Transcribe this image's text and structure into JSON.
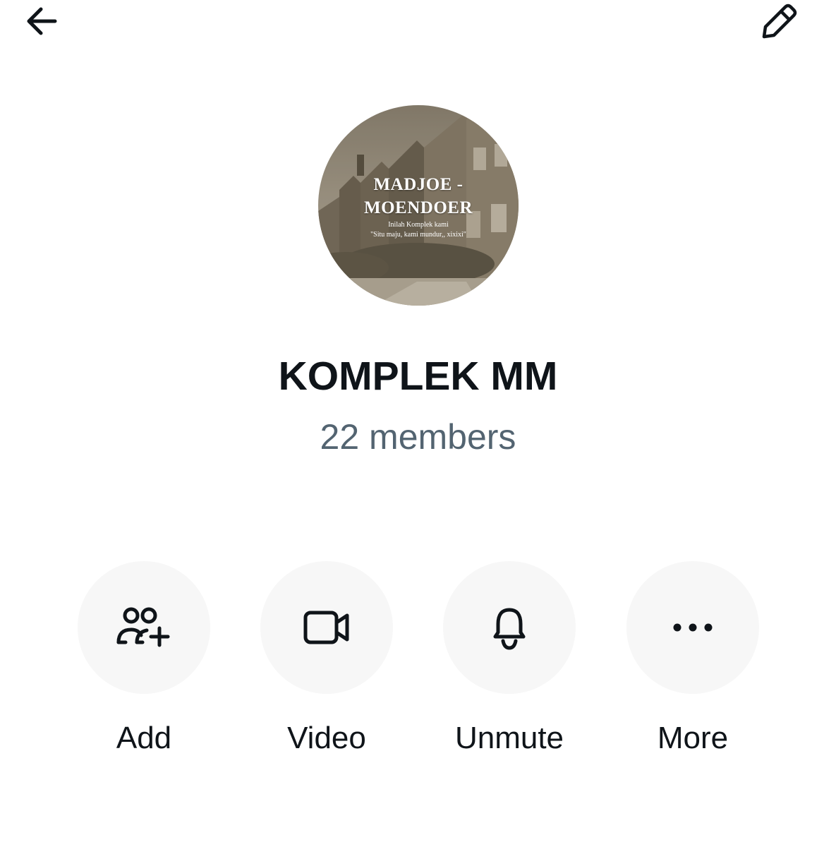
{
  "header": {
    "back_icon": "arrow-left-icon",
    "edit_icon": "pencil-icon"
  },
  "avatar": {
    "title": "MADJOE - MOENDOER",
    "subtitle_line1": "Inilah Komplek kami",
    "subtitle_line2": "\"Situ maju, kami mundur,, xixixi\""
  },
  "group": {
    "name": "KOMPLEK MM",
    "members": "22 members"
  },
  "actions": [
    {
      "label": "Add",
      "icon": "add-people-icon"
    },
    {
      "label": "Video",
      "icon": "video-camera-icon"
    },
    {
      "label": "Unmute",
      "icon": "bell-icon"
    },
    {
      "label": "More",
      "icon": "more-dots-icon"
    }
  ],
  "colors": {
    "text_primary": "#0f1419",
    "text_secondary": "#536471",
    "button_background": "#f7f7f7"
  }
}
